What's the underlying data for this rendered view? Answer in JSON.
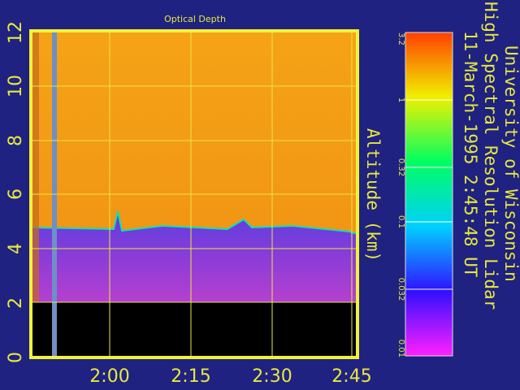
{
  "chart_data": {
    "type": "heatmap",
    "title": "Optical Depth",
    "ylabel": "Altitude (km)",
    "xlabel": "",
    "y_ticks": [
      "0",
      "2",
      "4",
      "6",
      "8",
      "10",
      "12"
    ],
    "x_ticks": [
      "2:00",
      "2:15",
      "2:30",
      "2:45"
    ],
    "ylim": [
      0,
      12
    ],
    "grid": true,
    "colorbar": {
      "scale": "log",
      "ticks": [
        "0.01",
        "0.032",
        "0.1",
        "0.32",
        "1",
        "3.2"
      ]
    },
    "cloud_top_km": 4.9,
    "data_floor_km": 2.0
  },
  "header": {
    "line1": "University of Wisconsin",
    "line2": "High Spectral Resolution Lidar",
    "line3": "11-March-1995   2:45:48 UT"
  },
  "colors": {
    "background": "#1f2280",
    "frame": "#f2f236",
    "grid": "#e8e840",
    "upper_fill": "#f29a16",
    "lower_fill": "#7c3fd8"
  }
}
